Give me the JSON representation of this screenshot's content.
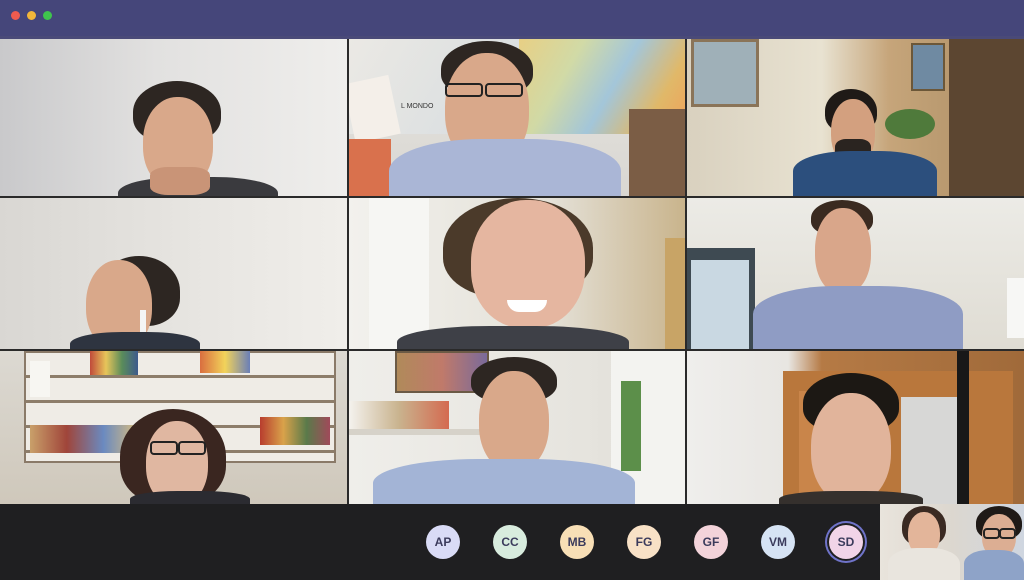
{
  "window": {
    "controls": [
      "close",
      "minimize",
      "maximize"
    ]
  },
  "tiles": [
    {
      "name": "tile-1"
    },
    {
      "name": "tile-2"
    },
    {
      "name": "tile-3"
    },
    {
      "name": "tile-4"
    },
    {
      "name": "tile-5"
    },
    {
      "name": "tile-6"
    },
    {
      "name": "tile-7"
    },
    {
      "name": "tile-8"
    },
    {
      "name": "tile-9"
    }
  ],
  "map_text": "L MONDO",
  "participants": [
    {
      "initials": "AP",
      "color": "#d9dbf6"
    },
    {
      "initials": "CC",
      "color": "#d8ecde"
    },
    {
      "initials": "MB",
      "color": "#f8dfb6"
    },
    {
      "initials": "FG",
      "color": "#f8e1c6"
    },
    {
      "initials": "GF",
      "color": "#f3d3da"
    },
    {
      "initials": "VM",
      "color": "#d6e3f4"
    },
    {
      "initials": "SD",
      "color": "#f1d4e8",
      "active": true
    }
  ]
}
